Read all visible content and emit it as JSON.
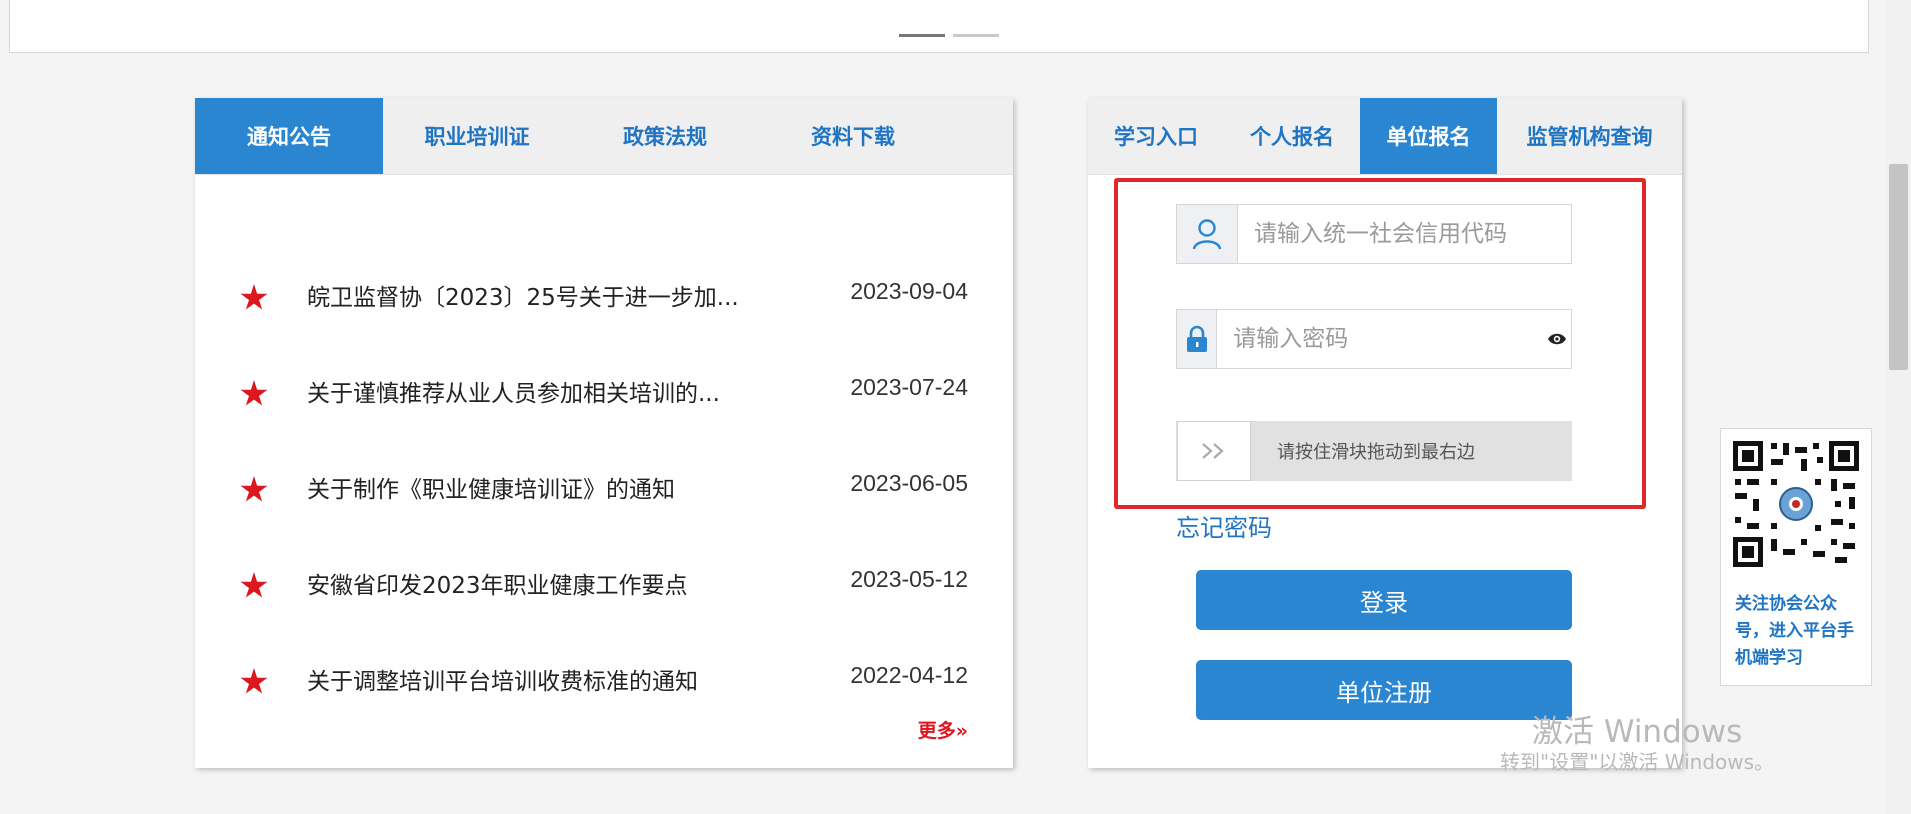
{
  "news": {
    "tabs": [
      "通知公告",
      "职业培训证",
      "政策法规",
      "资料下载"
    ],
    "items": [
      {
        "title": "皖卫监督协〔2023〕25号关于进一步加...",
        "date": "2023-09-04"
      },
      {
        "title": "关于谨慎推荐从业人员参加相关培训的...",
        "date": "2023-07-24"
      },
      {
        "title": "关于制作《职业健康培训证》的通知",
        "date": "2023-06-05"
      },
      {
        "title": "安徽省印发2023年职业健康工作要点",
        "date": "2023-05-12"
      },
      {
        "title": "关于调整培训平台培训收费标准的通知",
        "date": "2022-04-12"
      }
    ],
    "more": "更多»"
  },
  "login": {
    "tabs": [
      "学习入口",
      "个人报名",
      "单位报名",
      "监管机构查询"
    ],
    "active_tab": "单位报名",
    "credit_code_placeholder": "请输入统一社会信用代码",
    "password_placeholder": "请输入密码",
    "slider_text": "请按住滑块拖动到最右边",
    "forgot": "忘记密码",
    "login_button": "登录",
    "register_button": "单位注册"
  },
  "qr": {
    "caption": "关注协会公众号，进入平台手机端学习"
  },
  "watermark": {
    "line1": "激活 Windows",
    "line2": "转到\"设置\"以激活 Windows。"
  },
  "colors": {
    "accent": "#2b86d2",
    "link": "#1f74c4",
    "star": "#e0161e",
    "highlight_border": "#e3262b"
  }
}
